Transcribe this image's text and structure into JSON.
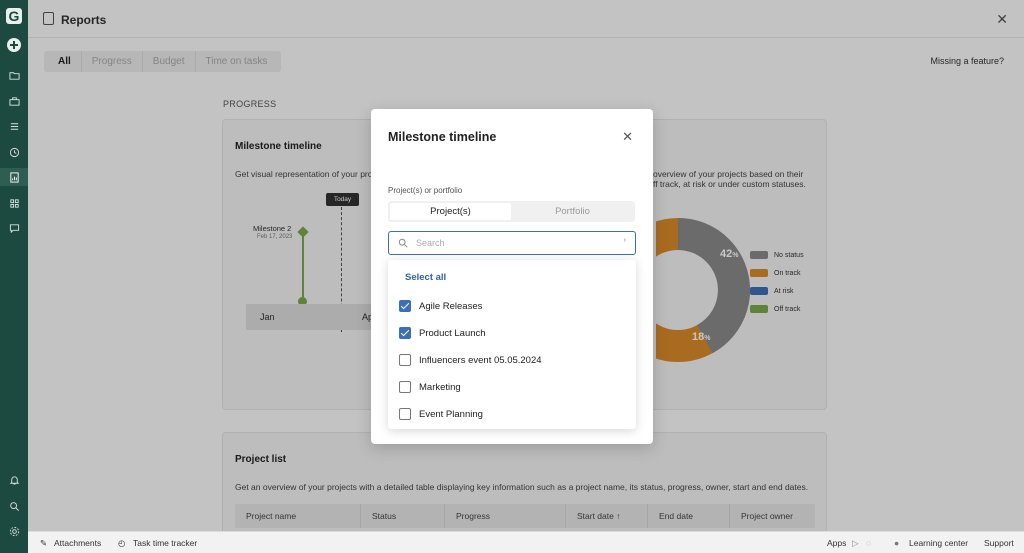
{
  "header": {
    "title": "Reports"
  },
  "tabs": [
    {
      "label": "All",
      "active": true
    },
    {
      "label": "Progress",
      "active": false
    },
    {
      "label": "Budget",
      "active": false
    },
    {
      "label": "Time on tasks",
      "active": false
    }
  ],
  "missing_feature": "Missing a feature?",
  "section_label": "PROGRESS",
  "milestone_card": {
    "title": "Milestone timeline",
    "description": "Get visual representation of your pro",
    "milestone_name": "Milestone 2",
    "milestone_date": "Feb 17, 2023",
    "today_label": "Today",
    "month1": "Jan",
    "month2": "Ap"
  },
  "status_card": {
    "description_line1": "overview of your projects based on their",
    "description_line2": "ff track, at risk or under custom statuses.",
    "donut_values": [
      {
        "label": "42",
        "unit": "%"
      },
      {
        "label": "18",
        "unit": "%"
      }
    ],
    "legend": [
      {
        "label": "No status",
        "color": "#8a8a8a"
      },
      {
        "label": "On track",
        "color": "#d98a2a"
      },
      {
        "label": "At risk",
        "color": "#3c6fb8"
      },
      {
        "label": "Off track",
        "color": "#7aa84a"
      }
    ]
  },
  "project_list": {
    "title": "Project list",
    "description": "Get an overview of your projects with a detailed table displaying key information such as a project name, its status, progress, owner, start and end dates.",
    "columns": [
      "Project name",
      "Status",
      "Progress",
      "Start date",
      "End date",
      "Project owner"
    ],
    "sort_indicator": "↑"
  },
  "modal": {
    "title": "Milestone timeline",
    "field_label": "Project(s) or portfolio",
    "seg_projects": "Project(s)",
    "seg_portfolio": "Portfolio",
    "search_placeholder": "Search",
    "select_all": "Select all",
    "options": [
      {
        "label": "Agile Releases",
        "checked": true
      },
      {
        "label": "Product Launch",
        "checked": true
      },
      {
        "label": "Influencers event 05.05.2024",
        "checked": false
      },
      {
        "label": "Marketing",
        "checked": false
      },
      {
        "label": "Event Planning",
        "checked": false
      }
    ]
  },
  "footer": {
    "attachments": "Attachments",
    "time_tracker": "Task time tracker",
    "apps": "Apps",
    "learning_center": "Learning center",
    "support": "Support"
  },
  "logo_letter": "G",
  "colors": {
    "sidebar": "#1c4a40",
    "accent": "#3c6fb8",
    "milestone": "#7aa84a"
  }
}
